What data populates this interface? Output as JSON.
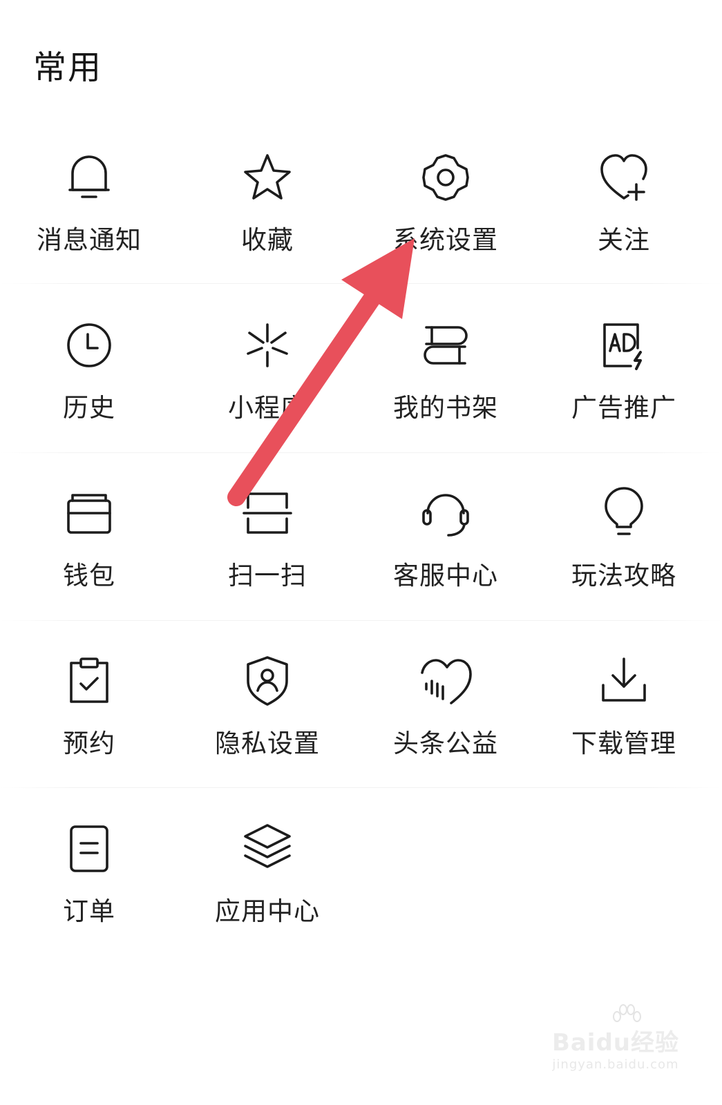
{
  "section": {
    "title": "常用"
  },
  "items": [
    {
      "label": "消息通知",
      "icon": "bell-icon"
    },
    {
      "label": "收藏",
      "icon": "star-icon"
    },
    {
      "label": "系统设置",
      "icon": "gear-icon"
    },
    {
      "label": "关注",
      "icon": "heart-plus-icon"
    },
    {
      "label": "历史",
      "icon": "clock-icon"
    },
    {
      "label": "小程序",
      "icon": "mini-program-icon"
    },
    {
      "label": "我的书架",
      "icon": "bookshelf-icon"
    },
    {
      "label": "广告推广",
      "icon": "ad-icon"
    },
    {
      "label": "钱包",
      "icon": "wallet-icon"
    },
    {
      "label": "扫一扫",
      "icon": "scan-icon"
    },
    {
      "label": "客服中心",
      "icon": "headset-icon"
    },
    {
      "label": "玩法攻略",
      "icon": "lightbulb-icon"
    },
    {
      "label": "预约",
      "icon": "clipboard-check-icon"
    },
    {
      "label": "隐私设置",
      "icon": "shield-user-icon"
    },
    {
      "label": "头条公益",
      "icon": "charity-heart-icon"
    },
    {
      "label": "下载管理",
      "icon": "download-icon"
    },
    {
      "label": "订单",
      "icon": "order-icon"
    },
    {
      "label": "应用中心",
      "icon": "layers-icon"
    }
  ],
  "annotation": {
    "arrow_color": "#e8505b"
  },
  "watermark": {
    "main": "Baidu经验",
    "sub": "jingyan.baidu.com"
  }
}
